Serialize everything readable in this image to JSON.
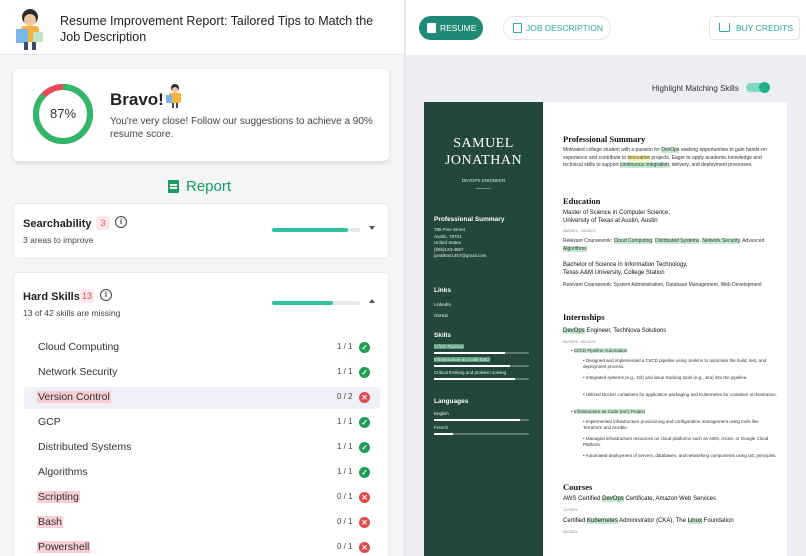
{
  "header": {
    "title": "Resume Improvement Report: Tailored Tips to Match the Job Description"
  },
  "score": {
    "value": 87,
    "value_label": "87%",
    "headline": "Bravo!",
    "message": "You're very close! Follow our suggestions to achieve a 90% resume score.",
    "colors": {
      "good": "#2fb86a",
      "bad": "#e54b57"
    }
  },
  "report": {
    "heading": "Report"
  },
  "sections": {
    "searchability": {
      "title": "Searchability",
      "count": "3",
      "subtitle": "3 areas to improve",
      "progress": 0.86
    },
    "hard_skills": {
      "title": "Hard Skills",
      "count": "13",
      "subtitle": "13 of 42 skills are missing",
      "progress": 0.69,
      "skills": [
        {
          "name": "Cloud Computing",
          "count": "1 / 1",
          "status": "ok"
        },
        {
          "name": "Network Security",
          "count": "1 / 1",
          "status": "ok"
        },
        {
          "name": "Version Control",
          "count": "0 / 2",
          "status": "missing"
        },
        {
          "name": "GCP",
          "count": "1 / 1",
          "status": "ok"
        },
        {
          "name": "Distributed Systems",
          "count": "1 / 1",
          "status": "ok"
        },
        {
          "name": "Algorithms",
          "count": "1 / 1",
          "status": "ok"
        },
        {
          "name": "Scripting",
          "count": "0 / 1",
          "status": "missing"
        },
        {
          "name": "Bash",
          "count": "0 / 1",
          "status": "missing"
        },
        {
          "name": "Powershell",
          "count": "0 / 1",
          "status": "missing"
        }
      ]
    }
  },
  "right": {
    "tabs": {
      "resume": "RESUME",
      "job_description": "JOB DESCRIPTION"
    },
    "buy_credits": "BUY CREDITS",
    "highlight_label": "Highlight Matching Skills",
    "highlight_on": true
  },
  "resume": {
    "first_name": "SAMUEL",
    "last_name": "JONATHAN",
    "role": "DEVOPS ENGINEER",
    "side": {
      "summary_title": "Professional Summary",
      "address1": "788 Pine Street",
      "address2": "Austin, 78701",
      "address3": "United States",
      "phone": "(555)123-4567",
      "email": "jonathan1457@gmail.com",
      "links_title": "Links",
      "link1": "LinkedIn",
      "link2": "GitHub",
      "skills_title": "Skills",
      "skills": [
        {
          "name": "CI/CD Pipeline",
          "level": 0.75
        },
        {
          "name": "Infrastructure as Code (IaC)",
          "level": 0.8
        },
        {
          "name": "Critical thinking and problem solving",
          "level": 0.85
        }
      ],
      "languages_title": "Languages",
      "languages": [
        {
          "name": "English",
          "level": 0.9
        },
        {
          "name": "French",
          "level": 0.2
        }
      ]
    },
    "main": {
      "summary_title": "Professional Summary",
      "summary_a": "Motivated college student with a passion for ",
      "summary_devops": "DevOps",
      "summary_b": " seeking opportunities to gain hands-on experience and contribute to ",
      "summary_innov": "innovative",
      "summary_c": " projects. Eager to apply academic knowledge and technical skills to support ",
      "summary_ci": "continuous integration",
      "summary_d": ", delivery, and deployment processes.",
      "education_title": "Education",
      "edu1_title": "Master of Science in Computer Science,",
      "edu1_school": "University of Texas at Austin, Austin",
      "edu1_date": "08/2021 - 05/2023",
      "edu1_courses_a": "Relevant Coursework: ",
      "edu1_c1": "Cloud Computing",
      "edu1_c2": "Distributed Systems",
      "edu1_c3": "Network Security",
      "edu1_courses_b": "Advanced ",
      "edu1_c4": "Algorithms",
      "edu2_title": "Bachelor of Science in Information Technology,",
      "edu2_school": "Texas A&M University, College Station",
      "edu2_courses": "Relevant Coursework: System Administration, Database Management, Web Development",
      "internships_title": "Internships",
      "intern_role_hl": "DevOps",
      "intern_role": " Engineer, TechNova Solutions",
      "intern_date": "06/2023 - 08/2024",
      "b1": "CI/CD Pipeline Automation",
      "b1a": "Designed and implemented a CI/CD pipeline using Jenkins to automate the build, test, and deployment process.",
      "b1b": "Integrated systems (e.g., Git) and issue tracking tools (e.g., Jira) into the pipeline.",
      "b1c": "Utilized Docker containers for application packaging and Kubernetes for container orchestration.",
      "b2": "Infrastructure as Code (IaC) Project",
      "b2a": "Implemented infrastructure provisioning and configuration management using tools like Terraform and Ansible.",
      "b2b": "Managed infrastructure resources on cloud platforms such as AWS, Azure, or Google Cloud Platform.",
      "b2c": "Automated deployment of servers, databases, and networking components using IaC principles.",
      "courses_title": "Courses",
      "course1_a": "AWS Certified ",
      "course1_hl": "DevOps",
      "course1_b": " Certificate, Amazon Web Services",
      "course1_date": "12/2023",
      "course2_a": "Certified ",
      "course2_hl": "Kubernetes",
      "course2_b": " Administrator (CKA), The ",
      "course2_hl2": "Linux",
      "course2_c": " Foundation",
      "course2_date": "08/2023"
    }
  }
}
